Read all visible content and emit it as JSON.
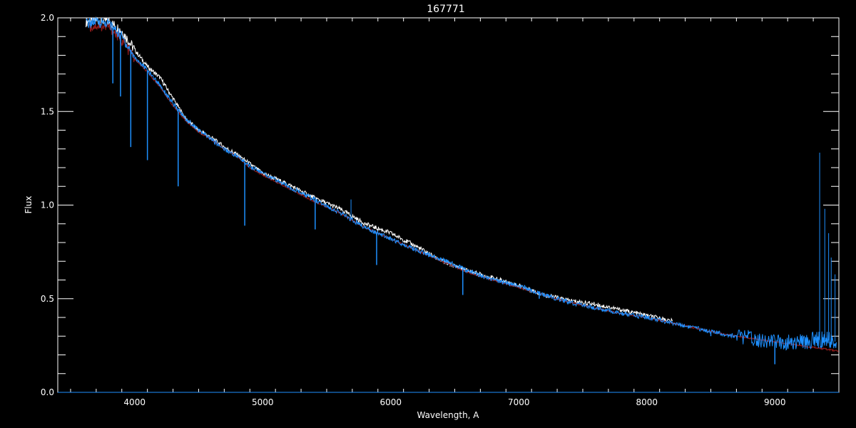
{
  "chart_data": {
    "type": "line",
    "title": "167771",
    "xlabel": "Wavelength, A",
    "ylabel": "Flux",
    "xlim": [
      3400,
      9500
    ],
    "ylim": [
      0.0,
      2.0
    ],
    "xticks": [
      4000,
      5000,
      6000,
      7000,
      8000,
      9000
    ],
    "yticks": [
      0.0,
      0.5,
      1.0,
      1.5,
      2.0
    ],
    "ytick_labels": [
      "0.0",
      "0.5",
      "1.0",
      "1.5",
      "2.0"
    ],
    "grid": false,
    "background": "#000000",
    "series": [
      {
        "color": "#ffffff",
        "x": [
          3620,
          3700,
          3800,
          3900,
          4000,
          4100,
          4200,
          4300,
          4400,
          4500,
          4600,
          4700,
          4800,
          4900,
          5000,
          5200,
          5400,
          5600,
          5800,
          6000,
          6200,
          6400,
          6600,
          6800,
          7000,
          7200,
          7400,
          7600,
          7800,
          8000,
          8200
        ],
        "y": [
          1.98,
          1.99,
          1.98,
          1.93,
          1.83,
          1.74,
          1.68,
          1.57,
          1.46,
          1.4,
          1.36,
          1.31,
          1.27,
          1.22,
          1.17,
          1.11,
          1.04,
          0.98,
          0.9,
          0.85,
          0.78,
          0.7,
          0.65,
          0.61,
          0.57,
          0.52,
          0.49,
          0.47,
          0.44,
          0.41,
          0.38
        ]
      },
      {
        "color": "#8b1a1a",
        "x": [
          3650,
          3700,
          3800,
          3900,
          4000,
          4100,
          4200,
          4300,
          4400,
          4500,
          4600,
          4700,
          4800,
          4900,
          5000,
          5200,
          5400,
          5600,
          5800,
          6000,
          6200,
          6400,
          6600,
          6800,
          7000,
          7200,
          7400,
          7600,
          7800,
          8000,
          8200,
          8400,
          8600,
          8800,
          9000,
          9200,
          9400,
          9500
        ],
        "y": [
          1.95,
          1.96,
          1.95,
          1.88,
          1.78,
          1.71,
          1.63,
          1.53,
          1.45,
          1.39,
          1.35,
          1.3,
          1.26,
          1.2,
          1.16,
          1.09,
          1.02,
          0.96,
          0.88,
          0.82,
          0.76,
          0.7,
          0.64,
          0.6,
          0.56,
          0.52,
          0.48,
          0.45,
          0.42,
          0.4,
          0.37,
          0.34,
          0.31,
          0.29,
          0.27,
          0.25,
          0.23,
          0.22
        ]
      },
      {
        "color": "#1e90ff",
        "x": [
          3620,
          3700,
          3800,
          3900,
          4000,
          4100,
          4200,
          4300,
          4400,
          4500,
          4600,
          4700,
          4800,
          4900,
          5000,
          5200,
          5400,
          5600,
          5800,
          6000,
          6200,
          6400,
          6600,
          6800,
          7000,
          7200,
          7400,
          7600,
          7800,
          8000,
          8200,
          8400,
          8600,
          8800,
          9000,
          9200,
          9300,
          9400,
          9480
        ],
        "y": [
          1.97,
          1.98,
          1.97,
          1.9,
          1.79,
          1.72,
          1.64,
          1.54,
          1.46,
          1.4,
          1.35,
          1.3,
          1.26,
          1.21,
          1.17,
          1.1,
          1.03,
          0.96,
          0.88,
          0.82,
          0.76,
          0.71,
          0.65,
          0.6,
          0.57,
          0.52,
          0.48,
          0.45,
          0.42,
          0.4,
          0.37,
          0.34,
          0.31,
          0.29,
          0.27,
          0.27,
          0.28,
          0.28,
          0.27
        ]
      },
      {
        "color": "#1e90ff",
        "x": [
          3400,
          5000,
          7000,
          8000,
          9000,
          9300,
          9500
        ],
        "y": [
          0.0,
          0.0,
          0.0,
          0.0,
          0.0,
          0.0,
          0.0
        ]
      }
    ],
    "absorption_lines": [
      {
        "x": 3830,
        "y": 1.65
      },
      {
        "x": 3890,
        "y": 1.58
      },
      {
        "x": 3970,
        "y": 1.31
      },
      {
        "x": 4100,
        "y": 1.24
      },
      {
        "x": 4340,
        "y": 1.1
      },
      {
        "x": 4860,
        "y": 0.89
      },
      {
        "x": 5410,
        "y": 0.87
      },
      {
        "x": 5890,
        "y": 0.68
      },
      {
        "x": 6563,
        "y": 0.52
      },
      {
        "x": 7160,
        "y": 0.5
      },
      {
        "x": 8500,
        "y": 0.3
      },
      {
        "x": 9000,
        "y": 0.15
      }
    ],
    "emission_spikes": [
      {
        "x": 5690,
        "y": 1.03
      },
      {
        "x": 9350,
        "y": 1.28
      },
      {
        "x": 9390,
        "y": 0.98
      },
      {
        "x": 9420,
        "y": 0.85
      },
      {
        "x": 9440,
        "y": 0.72
      },
      {
        "x": 9470,
        "y": 0.63
      }
    ]
  }
}
